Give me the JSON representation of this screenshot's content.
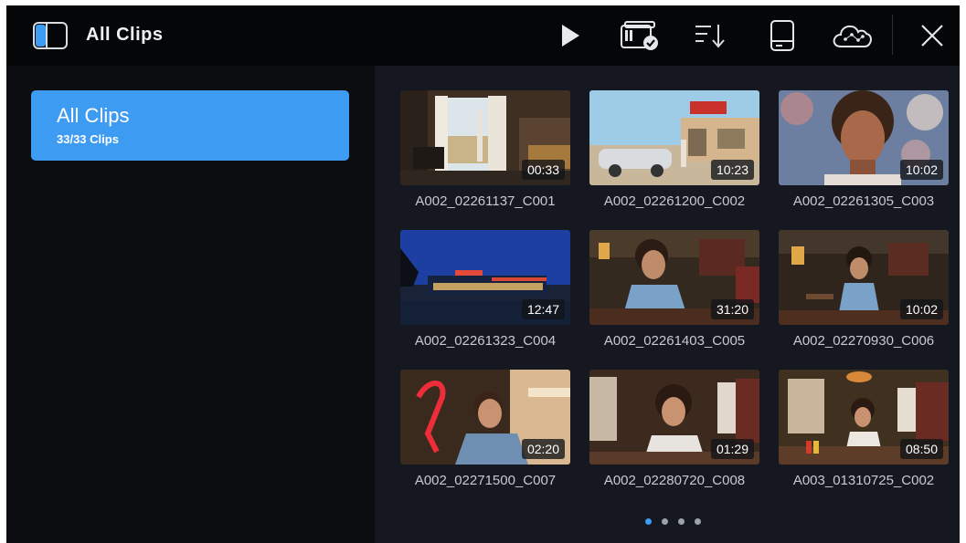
{
  "header": {
    "title": "All Clips",
    "icons": [
      "sidebar-toggle-icon",
      "play-icon",
      "media-card-check-icon",
      "sort-icon",
      "storage-drive-icon",
      "cloud-icon",
      "close-icon"
    ]
  },
  "sidebar": {
    "bins": [
      {
        "title": "All Clips",
        "count": "33/33 Clips",
        "selected": true
      }
    ]
  },
  "clips": [
    {
      "name": "A002_02261137_C001",
      "duration": "00:33"
    },
    {
      "name": "A002_02261200_C002",
      "duration": "10:23"
    },
    {
      "name": "A002_02261305_C003",
      "duration": "10:02"
    },
    {
      "name": "A002_02261323_C004",
      "duration": "12:47"
    },
    {
      "name": "A002_02261403_C005",
      "duration": "31:20"
    },
    {
      "name": "A002_02270930_C006",
      "duration": "10:02"
    },
    {
      "name": "A002_02271500_C007",
      "duration": "02:20"
    },
    {
      "name": "A002_02280720_C008",
      "duration": "01:29"
    },
    {
      "name": "A003_01310725_C002",
      "duration": "08:50"
    }
  ],
  "pagination": {
    "pages": 4,
    "current": 1
  },
  "colors": {
    "accent": "#3d9bf2",
    "background": "#0b0d11",
    "grid_background": "#151820"
  }
}
